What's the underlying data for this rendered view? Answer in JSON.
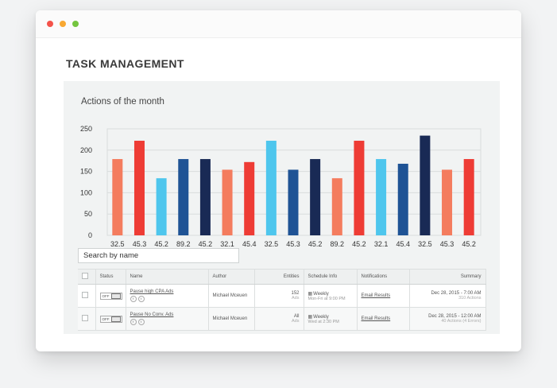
{
  "page": {
    "heading": "TASK MANAGEMENT",
    "chart_title": "Actions of the month",
    "search_placeholder": "Search by name"
  },
  "colors": {
    "salmon": "#f47c5e",
    "red": "#ee3c35",
    "light_blue": "#4ec6ed",
    "medium_blue": "#1f5395",
    "dark_navy": "#192a55"
  },
  "chart_data": {
    "type": "bar",
    "categories": [
      "32.5",
      "45.3",
      "45.2",
      "89.2",
      "45.2",
      "32.1",
      "45.4",
      "32.5",
      "45.3",
      "45.2",
      "89.2",
      "45.2",
      "32.1",
      "45.4",
      "32.5",
      "45.3",
      "45.2"
    ],
    "values": [
      179,
      222,
      134,
      179,
      179,
      154,
      172,
      222,
      154,
      179,
      134,
      222,
      179,
      168,
      234,
      154,
      179
    ],
    "bar_colors": [
      "#f47c5e",
      "#ee3c35",
      "#4ec6ed",
      "#1f5395",
      "#192a55",
      "#f47c5e",
      "#ee3c35",
      "#4ec6ed",
      "#1f5395",
      "#192a55",
      "#f47c5e",
      "#ee3c35",
      "#4ec6ed",
      "#1f5395",
      "#192a55",
      "#f47c5e",
      "#ee3c35"
    ],
    "title": "Actions of the month",
    "xlabel": "",
    "ylabel": "",
    "ylim": [
      0,
      250
    ],
    "yticks": [
      "250",
      "200",
      "150",
      "100",
      "50",
      "0"
    ],
    "grid": true
  },
  "table": {
    "columns": [
      "",
      "Status",
      "Name",
      "Author",
      "Entities",
      "Schedule Info",
      "Notifications",
      "Summary"
    ],
    "rows": [
      {
        "status": "OFF",
        "name": "Pause high CPA Ads",
        "author": "Michael Mceuen",
        "entities_count": "152",
        "entities_unit": "Ads",
        "schedule": "Weekly",
        "schedule_detail": "Mon-Fri at 9:00 PM",
        "notification": "Email Results",
        "summary_date": "Dec 28, 2015 - 7:00 AM",
        "summary_detail": "310 Actions"
      },
      {
        "status": "OFF",
        "name": "Pause No Conv. Ads",
        "author": "Michael Mceuen",
        "entities_count": "All",
        "entities_unit": "Ads",
        "schedule": "Weekly",
        "schedule_detail": "Wed at 2:30 PM",
        "notification": "Email Results",
        "summary_date": "Dec 28, 2015 - 12:00 AM",
        "summary_detail": "40 Actions (4 Errors)"
      }
    ]
  }
}
